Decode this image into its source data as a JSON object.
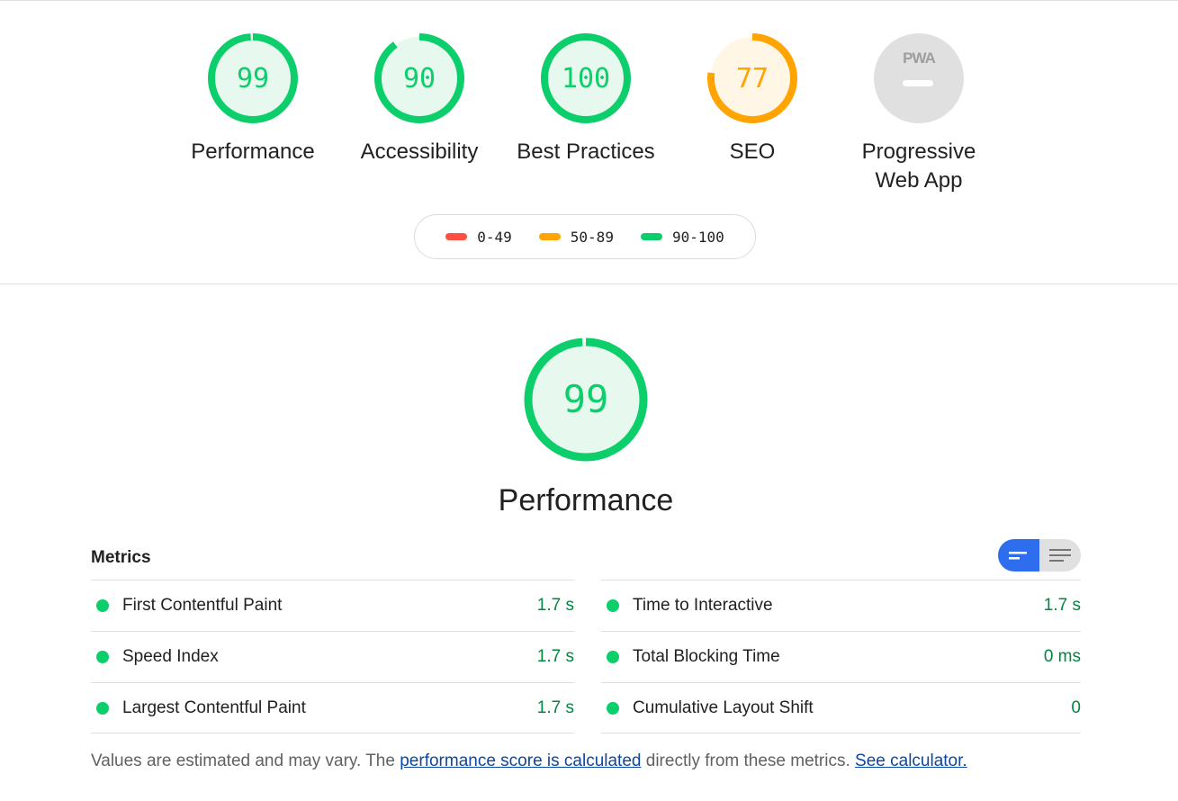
{
  "categories": [
    {
      "label": "Performance",
      "score": "99",
      "value": 99,
      "color": "#0cce6b",
      "fill": "#e7f8ef",
      "text_color": "#0cce6b"
    },
    {
      "label": "Accessibility",
      "score": "90",
      "value": 90,
      "color": "#0cce6b",
      "fill": "#e7f8ef",
      "text_color": "#0cce6b"
    },
    {
      "label": "Best Practices",
      "score": "100",
      "value": 100,
      "color": "#0cce6b",
      "fill": "#e7f8ef",
      "text_color": "#0cce6b"
    },
    {
      "label": "SEO",
      "score": "77",
      "value": 77,
      "color": "#ffa400",
      "fill": "#fff6e6",
      "text_color": "#ffa400"
    },
    {
      "label": "Progressive Web App",
      "line1": "Progressive",
      "line2": "Web App",
      "badge": "PWA",
      "icon": "pwa-badge-icon",
      "fill": "#e0e0e0"
    }
  ],
  "legend": [
    {
      "range": "0-49",
      "color": "#ff4e42"
    },
    {
      "range": "50-89",
      "color": "#ffa400"
    },
    {
      "range": "90-100",
      "color": "#0cce6b"
    }
  ],
  "performance": {
    "title": "Performance",
    "score": "99",
    "value": 99,
    "color": "#0cce6b",
    "fill": "#e7f8ef"
  },
  "metrics": {
    "title": "Metrics",
    "toggle": {
      "active": "bar-view-icon",
      "inactive": "list-view-icon",
      "active_color": "#2e6ded"
    },
    "left": [
      {
        "name": "First Contentful Paint",
        "value": "1.7 s"
      },
      {
        "name": "Speed Index",
        "value": "1.7 s"
      },
      {
        "name": "Largest Contentful Paint",
        "value": "1.7 s"
      }
    ],
    "right": [
      {
        "name": "Time to Interactive",
        "value": "1.7 s"
      },
      {
        "name": "Total Blocking Time",
        "value": "0 ms"
      },
      {
        "name": "Cumulative Layout Shift",
        "value": "0"
      }
    ],
    "status_color": "#0cce6b",
    "value_color": "#018642"
  },
  "footnote": {
    "prefix": "Values are estimated and may vary. The ",
    "link1": "performance score is calculated",
    "middle": " directly from these metrics. ",
    "link2": "See calculator."
  }
}
